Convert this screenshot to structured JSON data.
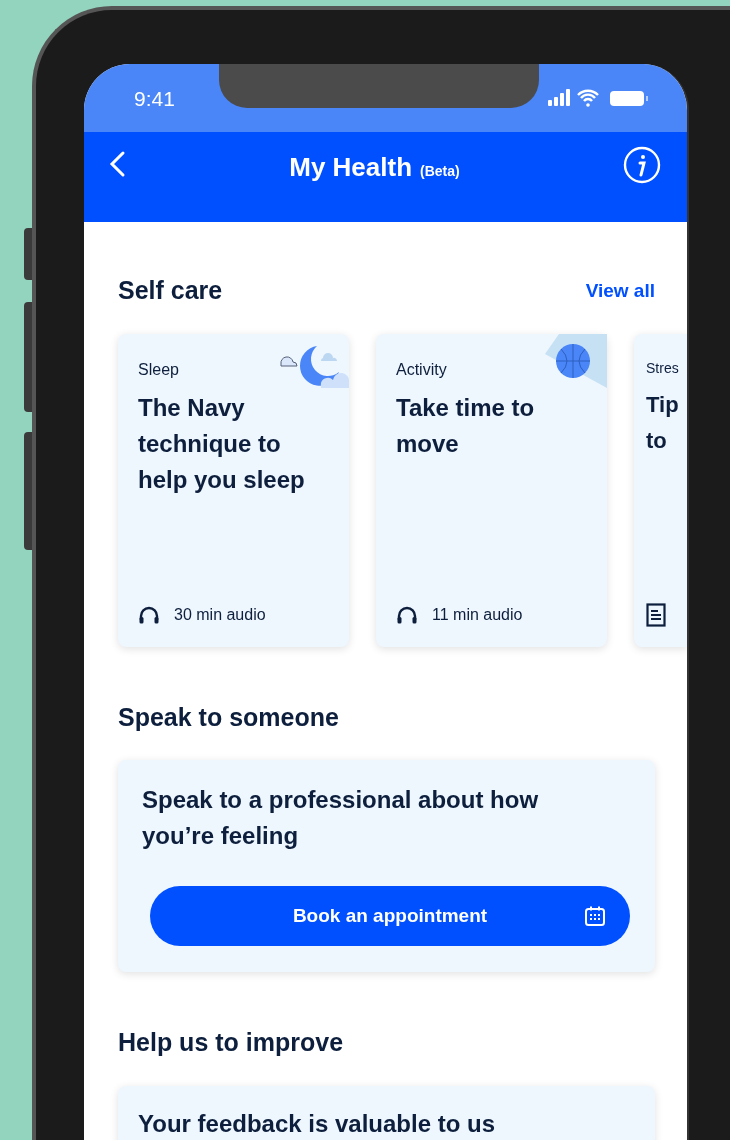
{
  "status_bar": {
    "time": "9:41"
  },
  "header": {
    "title": "My Health",
    "badge": "(Beta)"
  },
  "self_care": {
    "title": "Self care",
    "link": "View all",
    "cards": [
      {
        "illustration": {
          "kind": "moon"
        },
        "category": "Sleep",
        "title": "The Navy technique to help you sleep",
        "media": {
          "kind": "audio"
        },
        "meta": "30 min audio"
      },
      {
        "illustration": {
          "kind": "ball"
        },
        "category": "Activity",
        "title": "Take time to move",
        "media": {
          "kind": "audio"
        },
        "meta": "11 min audio"
      },
      {
        "category": "Stres",
        "title": "Tip to",
        "media": {
          "kind": "article"
        }
      }
    ]
  },
  "speak": {
    "title": "Speak to someone",
    "text": "Speak to a professional about how you’re feeling",
    "button": "Book an appointment"
  },
  "improve": {
    "title": "Help us to improve",
    "text": "Your feedback is valuable to us"
  }
}
